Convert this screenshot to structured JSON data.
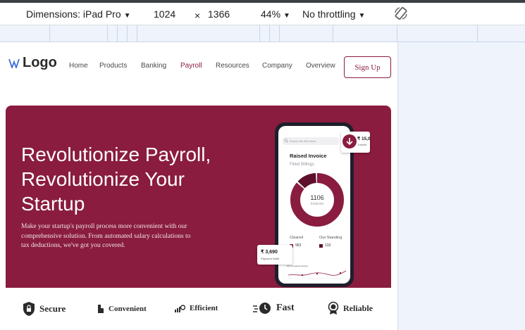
{
  "devtools": {
    "dimensions_label": "Dimensions: iPad Pro",
    "width": "1024",
    "times": "×",
    "height": "1366",
    "zoom": "44%",
    "throttling": "No throttling"
  },
  "site": {
    "logo_text": "Logo",
    "nav": [
      "Home",
      "Products",
      "Banking",
      "Payroll",
      "Resources",
      "Company",
      "Overview"
    ],
    "active_nav": "Payroll",
    "signup_label": "Sign Up"
  },
  "hero": {
    "title": "Revolutionize Payroll, Revolutionize Your Startup",
    "description": "Make your startup's payroll process more convenient with our comprehensive solution. From automated salary calculations to tax deductions, we've got you covered."
  },
  "phone": {
    "search_placeholder": "Search the Bill Name",
    "card_title": "Raised Invoice",
    "card_subtitle": "Filled Billings",
    "donut_value": "1106",
    "donut_label": "Invoices",
    "donut_cleared_share": 0.87,
    "cleared_label": "Cleared",
    "cleared_value": "963",
    "outstanding_label": "Out-Standing",
    "outstanding_value": "133",
    "transfer_amount": "₹ 15,0",
    "transfer_label": "Transfe",
    "payment_amount": "₹ 3,690",
    "payment_label": "Payment Debit",
    "chart_title": "My Transaction Report"
  },
  "features": [
    "Secure",
    "Convenient",
    "Efficient",
    "Fast",
    "Reliable"
  ],
  "colors": {
    "brand": "#8a1c3f",
    "brand_light": "#d9b5c2",
    "dark_segment": "#5e0f2c"
  }
}
